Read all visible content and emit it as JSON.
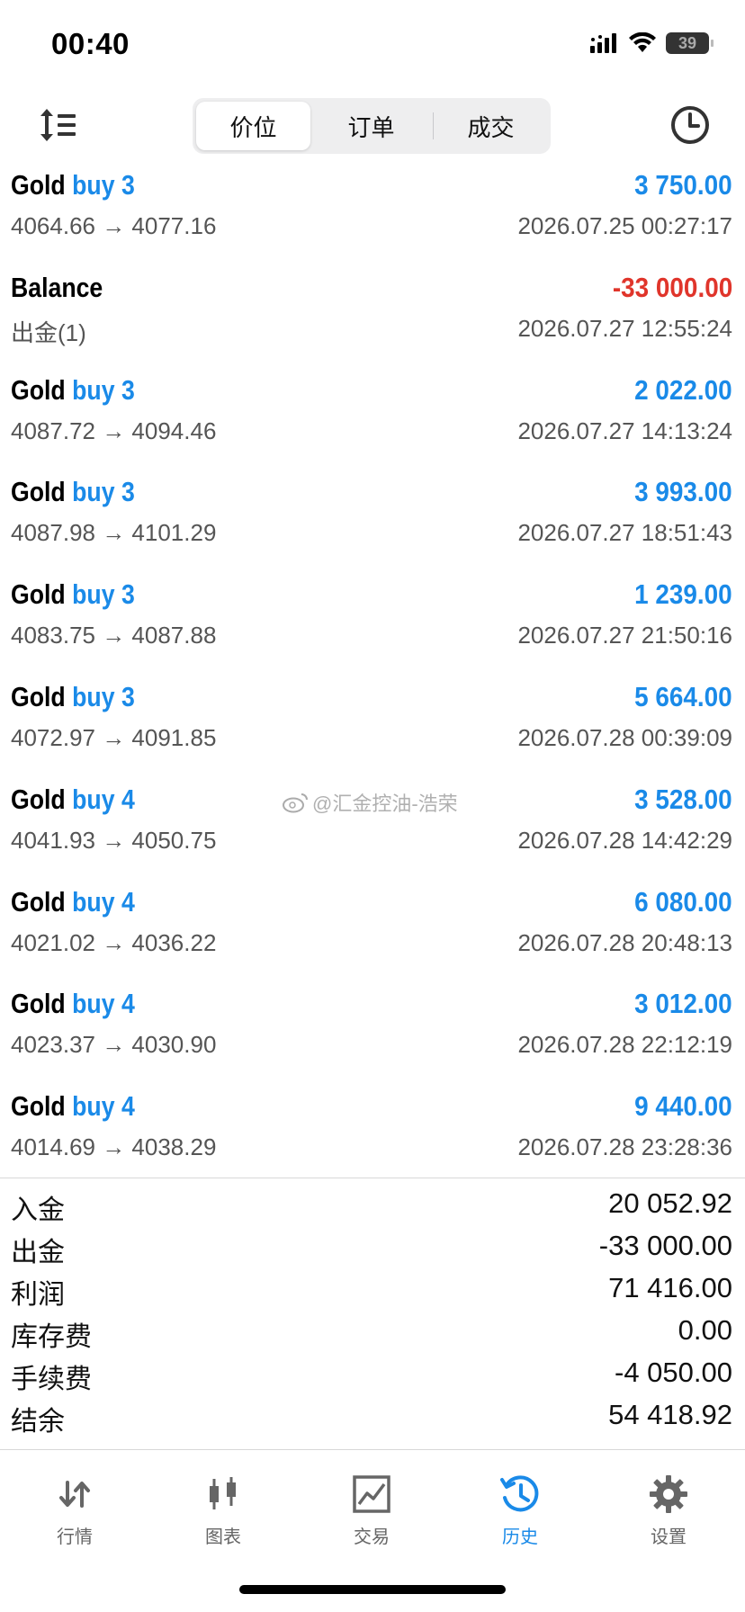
{
  "status": {
    "time": "00:40",
    "battery": "39"
  },
  "tabs": [
    "价位",
    "订单",
    "成交"
  ],
  "active_tab": 0,
  "deals": [
    {
      "symbol": "Gold",
      "type": "buy 3",
      "profit": "3 750.00",
      "prices": "4064.66 → 4077.16",
      "time": "2026.07.25 00:27:17"
    },
    {
      "symbol": "Balance",
      "type": "",
      "profit": "-33 000.00",
      "prices": "出金(1)",
      "time": "2026.07.27 12:55:24"
    },
    {
      "symbol": "Gold",
      "type": "buy 3",
      "profit": "2 022.00",
      "prices": "4087.72 → 4094.46",
      "time": "2026.07.27 14:13:24"
    },
    {
      "symbol": "Gold",
      "type": "buy 3",
      "profit": "3 993.00",
      "prices": "4087.98 → 4101.29",
      "time": "2026.07.27 18:51:43"
    },
    {
      "symbol": "Gold",
      "type": "buy 3",
      "profit": "1 239.00",
      "prices": "4083.75 → 4087.88",
      "time": "2026.07.27 21:50:16"
    },
    {
      "symbol": "Gold",
      "type": "buy 3",
      "profit": "5 664.00",
      "prices": "4072.97 → 4091.85",
      "time": "2026.07.28 00:39:09"
    },
    {
      "symbol": "Gold",
      "type": "buy 4",
      "profit": "3 528.00",
      "prices": "4041.93 → 4050.75",
      "time": "2026.07.28 14:42:29"
    },
    {
      "symbol": "Gold",
      "type": "buy 4",
      "profit": "6 080.00",
      "prices": "4021.02 → 4036.22",
      "time": "2026.07.28 20:48:13"
    },
    {
      "symbol": "Gold",
      "type": "buy 4",
      "profit": "3 012.00",
      "prices": "4023.37 → 4030.90",
      "time": "2026.07.28 22:12:19"
    },
    {
      "symbol": "Gold",
      "type": "buy 4",
      "profit": "9 440.00",
      "prices": "4014.69 → 4038.29",
      "time": "2026.07.28 23:28:36"
    }
  ],
  "watermark": "@汇金控油-浩荣",
  "summary": [
    {
      "label": "入金",
      "value": "20 052.92"
    },
    {
      "label": "出金",
      "value": "-33 000.00"
    },
    {
      "label": "利润",
      "value": "71 416.00"
    },
    {
      "label": "库存费",
      "value": "0.00"
    },
    {
      "label": "手续费",
      "value": "-4 050.00"
    },
    {
      "label": "结余",
      "value": "54 418.92"
    }
  ],
  "bottom_nav": [
    {
      "label": "行情",
      "icon": "quotes-arrows-icon"
    },
    {
      "label": "图表",
      "icon": "candlestick-chart-icon"
    },
    {
      "label": "交易",
      "icon": "trade-chart-icon"
    },
    {
      "label": "历史",
      "icon": "history-clock-icon"
    },
    {
      "label": "设置",
      "icon": "gear-icon"
    }
  ],
  "active_nav": 3,
  "colors": {
    "accent": "#1a8ae8",
    "negative": "#e0352b",
    "text_secondary": "#555555"
  }
}
